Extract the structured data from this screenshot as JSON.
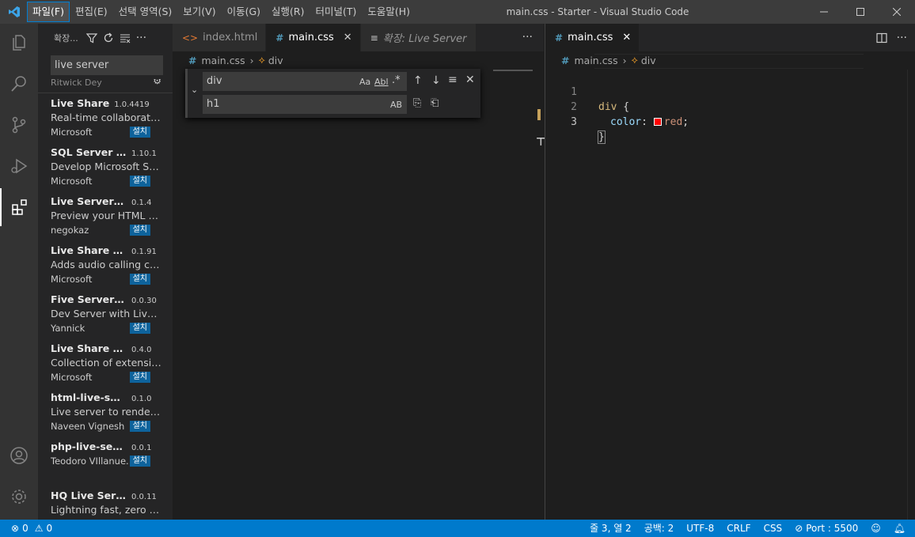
{
  "window": {
    "title": "main.css - Starter - Visual Studio Code",
    "menu": [
      "파일(F)",
      "편집(E)",
      "선택 영역(S)",
      "보기(V)",
      "이동(G)",
      "실행(R)",
      "터미널(T)",
      "도움말(H)"
    ]
  },
  "sidebar": {
    "title": "확장...",
    "search_value": "live server",
    "cut_item_publisher": "Ritwick Dey",
    "install_label": "설치",
    "extensions": [
      {
        "name": "Live Share",
        "version": "1.0.4419",
        "description": "Real-time collaborative...",
        "publisher": "Microsoft"
      },
      {
        "name": "SQL Server (...",
        "version": "1.10.1",
        "description": "Develop Microsoft SQL...",
        "publisher": "Microsoft"
      },
      {
        "name": "Live Server P...",
        "version": "0.1.4",
        "description": "Preview your HTML file...",
        "publisher": "negokaz"
      },
      {
        "name": "Live Share Au...",
        "version": "0.1.91",
        "description": "Adds audio calling cap...",
        "publisher": "Microsoft"
      },
      {
        "name": "Five Server (L...",
        "version": "0.0.30",
        "description": "Dev Server with Live Re...",
        "publisher": "Yannick"
      },
      {
        "name": "Live Share Ex...",
        "version": "0.4.0",
        "description": "Collection of extension...",
        "publisher": "Microsoft"
      },
      {
        "name": "html-live-ser...",
        "version": "0.1.0",
        "description": "Live server to render ht...",
        "publisher": "Naveen Vignesh"
      },
      {
        "name": "php-live-server",
        "version": "0.0.1",
        "description": "",
        "publisher": "Teodoro VIllanue..."
      },
      {
        "name": "HQ Live Server",
        "version": "0.0.11",
        "description": "Lightning fast, zero co...",
        "publisher": ""
      }
    ]
  },
  "group1": {
    "tabs": [
      {
        "label": "index.html",
        "icon": "html-file-icon"
      },
      {
        "label": "main.css",
        "icon": "css-file-icon"
      },
      {
        "label": "확장: Live Server",
        "icon": "extension-preview-icon"
      }
    ],
    "breadcrumb": {
      "file": "main.css",
      "symbol": "div"
    },
    "find": {
      "search_value": "div",
      "replace_value": "h1",
      "match_case": "Aa",
      "whole_word": "Abl",
      "regex": ".*",
      "preserve_case": "AB"
    }
  },
  "group2": {
    "tab": {
      "label": "main.css"
    },
    "breadcrumb": {
      "file": "main.css",
      "symbol": "div"
    },
    "code_lines": [
      {
        "number": "1",
        "selector": "div",
        "open": " {"
      },
      {
        "number": "2",
        "property": "color",
        "colon": ": ",
        "value": "red",
        "semi": ";"
      },
      {
        "number": "3",
        "close": "}"
      }
    ],
    "swatch_color": "#ff0000"
  },
  "statusbar": {
    "errors": "0",
    "warnings": "0",
    "position": "줄 3, 열 2",
    "spaces": "공백: 2",
    "encoding": "UTF-8",
    "eol": "CRLF",
    "language": "CSS",
    "port": "Port : 5500"
  },
  "colors": {
    "accent": "#007acc",
    "install_button": "#0e639c",
    "css_icon": "#519aba",
    "html_icon": "#e37933"
  }
}
